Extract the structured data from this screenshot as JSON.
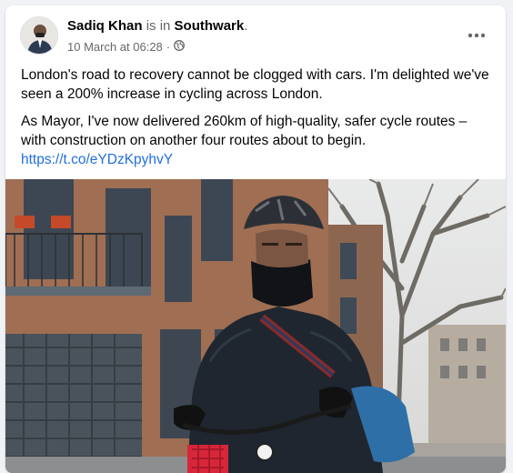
{
  "author": {
    "name": "Sadiq Khan",
    "is_in": "is in",
    "location": "Southwark",
    "period": "."
  },
  "meta": {
    "timestamp": "10 March at 06:28",
    "separator": "·",
    "privacy_icon": "globe-icon"
  },
  "more_icon": "ellipsis-icon",
  "post": {
    "paragraph1": "London's road to recovery cannot be clogged with cars. I'm delighted we've seen a 200% increase in cycling across London.",
    "paragraph2": "As Mayor, I've now delivered 260km of high-quality, safer cycle routes – with construction on another four routes about to begin.",
    "link": "https://t.co/eYDzKpyhvY"
  },
  "colors": {
    "link": "#216fdb",
    "text": "#050505",
    "secondary": "#65676b"
  }
}
